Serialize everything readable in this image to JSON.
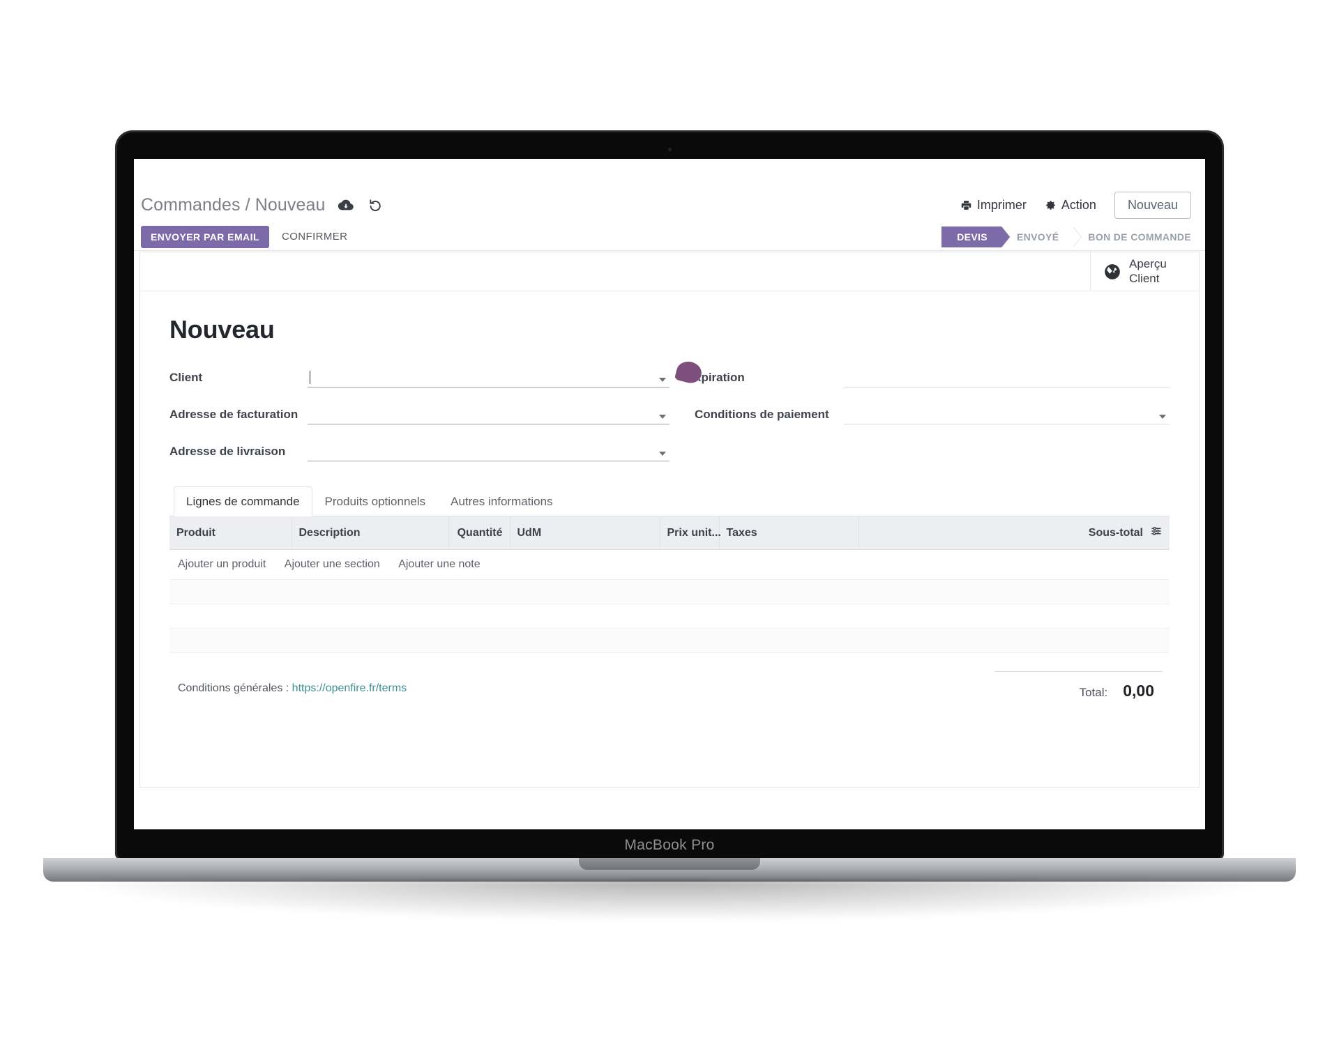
{
  "device": {
    "model_label": "MacBook Pro"
  },
  "control_panel": {
    "breadcrumb": "Commandes / Nouveau",
    "save_icon": "cloud-upload-icon",
    "discard_icon": "undo-icon",
    "print_label": "Imprimer",
    "print_icon": "printer-icon",
    "action_label": "Action",
    "action_icon": "gear-icon",
    "new_label": "Nouveau"
  },
  "statusbar": {
    "send_by_email_label": "ENVOYER PAR EMAIL",
    "confirm_label": "CONFIRMER",
    "accent_color": "#7c6ba8",
    "pipeline": [
      {
        "label": "DEVIS",
        "active": true
      },
      {
        "label": "ENVOYÉ",
        "active": false
      },
      {
        "label": "BON DE COMMANDE",
        "active": false
      }
    ]
  },
  "button_box": {
    "customer_preview_line1": "Aperçu",
    "customer_preview_line2": "Client",
    "customer_preview_icon": "globe-icon"
  },
  "form": {
    "title": "Nouveau",
    "left_fields": [
      {
        "label": "Client",
        "value": "",
        "placeholder": "",
        "focused": true
      },
      {
        "label": "Adresse de facturation",
        "value": "",
        "placeholder": "",
        "focused": false
      },
      {
        "label": "Adresse de livraison",
        "value": "",
        "placeholder": "",
        "focused": false
      }
    ],
    "right_fields": [
      {
        "label": "Expiration",
        "value": "",
        "placeholder": "",
        "obscured_label": "xpiration"
      },
      {
        "label": "Conditions de paiement",
        "value": "",
        "placeholder": ""
      }
    ],
    "cursor_overlay_color": "#7c4f7d"
  },
  "notebook": {
    "tabs": [
      {
        "label": "Lignes de commande",
        "active": true
      },
      {
        "label": "Produits optionnels",
        "active": false
      },
      {
        "label": "Autres informations",
        "active": false
      }
    ]
  },
  "order_lines": {
    "columns": [
      "Produit",
      "Description",
      "Quantité",
      "UdM",
      "Prix unit...",
      "Taxes",
      "Sous-total"
    ],
    "optional_columns_icon": "column-settings-icon",
    "rows": [],
    "add_links": [
      "Ajouter un produit",
      "Ajouter une section",
      "Ajouter une note"
    ]
  },
  "footer": {
    "terms_label": "Conditions générales :",
    "terms_url": "https://openfire.fr/terms",
    "terms_link_color": "#3f8f93",
    "total_label": "Total:",
    "total_amount": "0,00"
  }
}
